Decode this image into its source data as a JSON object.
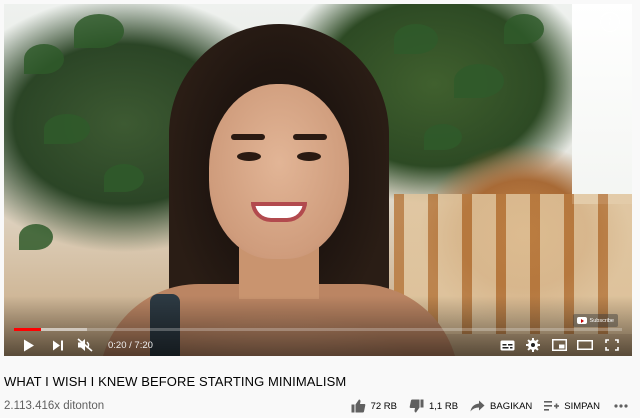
{
  "player": {
    "current_time": "0:20",
    "duration": "7:20",
    "time_separator": "/",
    "progress_fraction": 0.045,
    "buffered_fraction": 0.12,
    "watermark_text": "Subscribe",
    "colors": {
      "progress": "#ff0000",
      "controls": "#ffffff"
    }
  },
  "video": {
    "title": "WHAT I WISH I KNEW BEFORE STARTING MINIMALISM",
    "views": "2.113.416x ditonton"
  },
  "actions": {
    "like_count": "72 RB",
    "dislike_count": "1,1 RB",
    "share_label": "BAGIKAN",
    "save_label": "SIMPAN"
  },
  "icons": [
    "play-icon",
    "next-icon",
    "mute-icon",
    "subtitles-icon",
    "settings-icon",
    "miniplayer-icon",
    "theater-icon",
    "fullscreen-icon",
    "info-icon",
    "like-icon",
    "dislike-icon",
    "share-icon",
    "save-icon",
    "more-icon"
  ]
}
